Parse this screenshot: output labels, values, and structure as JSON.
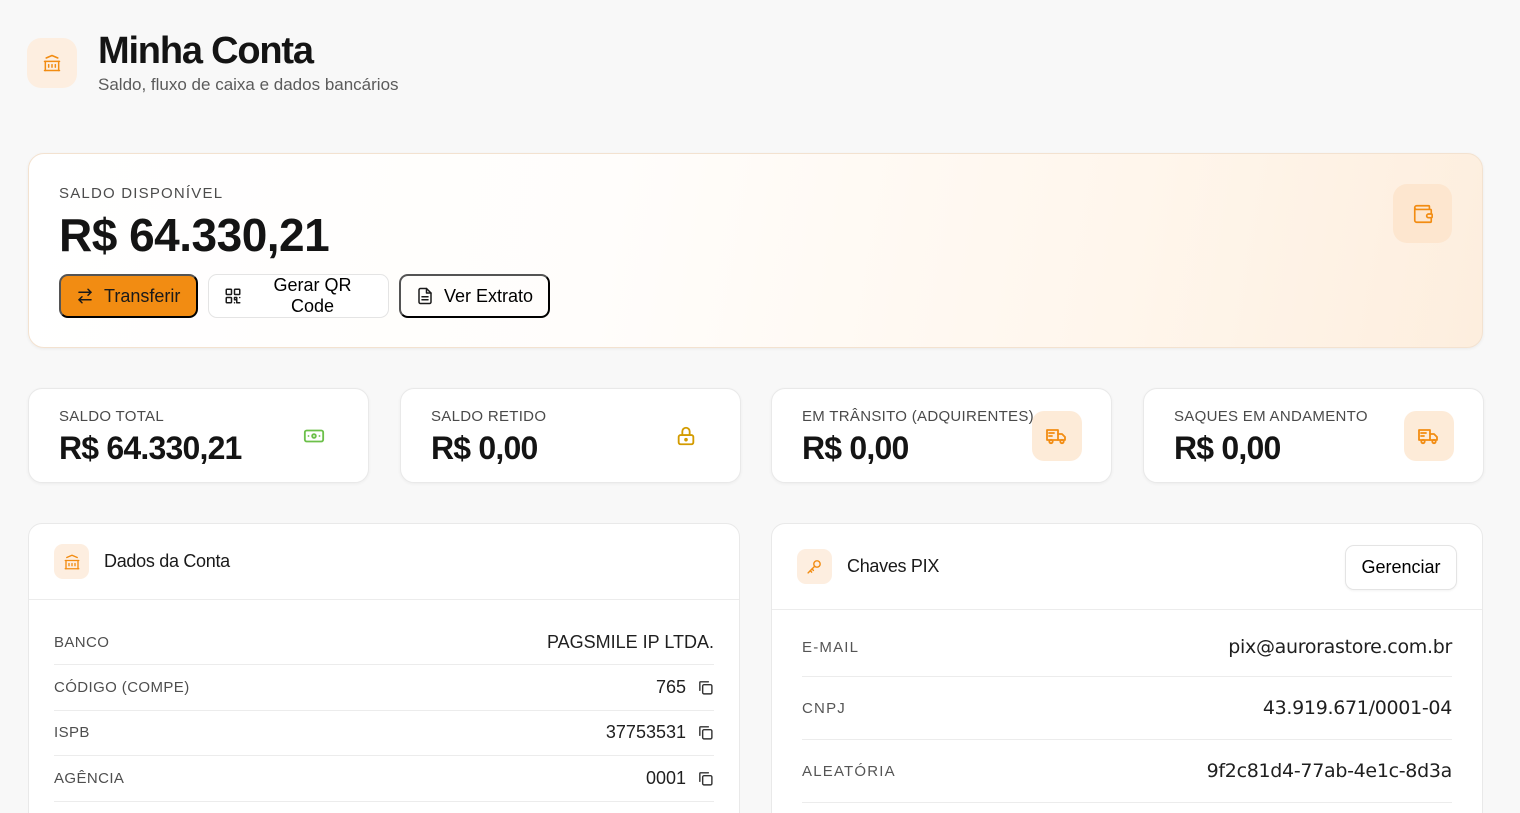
{
  "header": {
    "title": "Minha Conta",
    "subtitle": "Saldo, fluxo de caixa e dados bancários",
    "icon": "bank-icon"
  },
  "balance": {
    "label": "SALDO DISPONÍVEL",
    "value": "R$ 64.330,21",
    "icon": "wallet-icon",
    "actions": {
      "transfer": "Transferir",
      "qr_code": "Gerar QR Code",
      "statement": "Ver Extrato"
    }
  },
  "stats": [
    {
      "label": "SALDO TOTAL",
      "value": "R$ 64.330,21",
      "icon": "banknote-icon"
    },
    {
      "label": "SALDO RETIDO",
      "value": "R$ 0,00",
      "icon": "lock-icon"
    },
    {
      "label": "EM TRÂNSITO (ADQUIRENTES)",
      "value": "R$ 0,00",
      "icon": "truck-icon"
    },
    {
      "label": "SAQUES EM ANDAMENTO",
      "value": "R$ 0,00",
      "icon": "truck-icon"
    }
  ],
  "account": {
    "title": "Dados da Conta",
    "rows": [
      {
        "label": "BANCO",
        "value": "PAGSMILE IP LTDA."
      },
      {
        "label": "CÓDIGO (COMPE)",
        "value": "765"
      },
      {
        "label": "ISPB",
        "value": "37753531"
      },
      {
        "label": "AGÊNCIA",
        "value": "0001"
      }
    ]
  },
  "pix": {
    "title": "Chaves PIX",
    "manage_label": "Gerenciar",
    "rows": [
      {
        "label": "E-MAIL",
        "value": "pix@aurorastore.com.br"
      },
      {
        "label": "CNPJ",
        "value": "43.919.671/0001-04"
      },
      {
        "label": "ALEATÓRIA",
        "value": "9f2c81d4-77ab-4e1c-8d3a"
      }
    ]
  },
  "colors": {
    "accent": "#f28c12",
    "accent_soft": "#fdeee0",
    "success": "#6cc04a",
    "warning": "#d39b00"
  }
}
